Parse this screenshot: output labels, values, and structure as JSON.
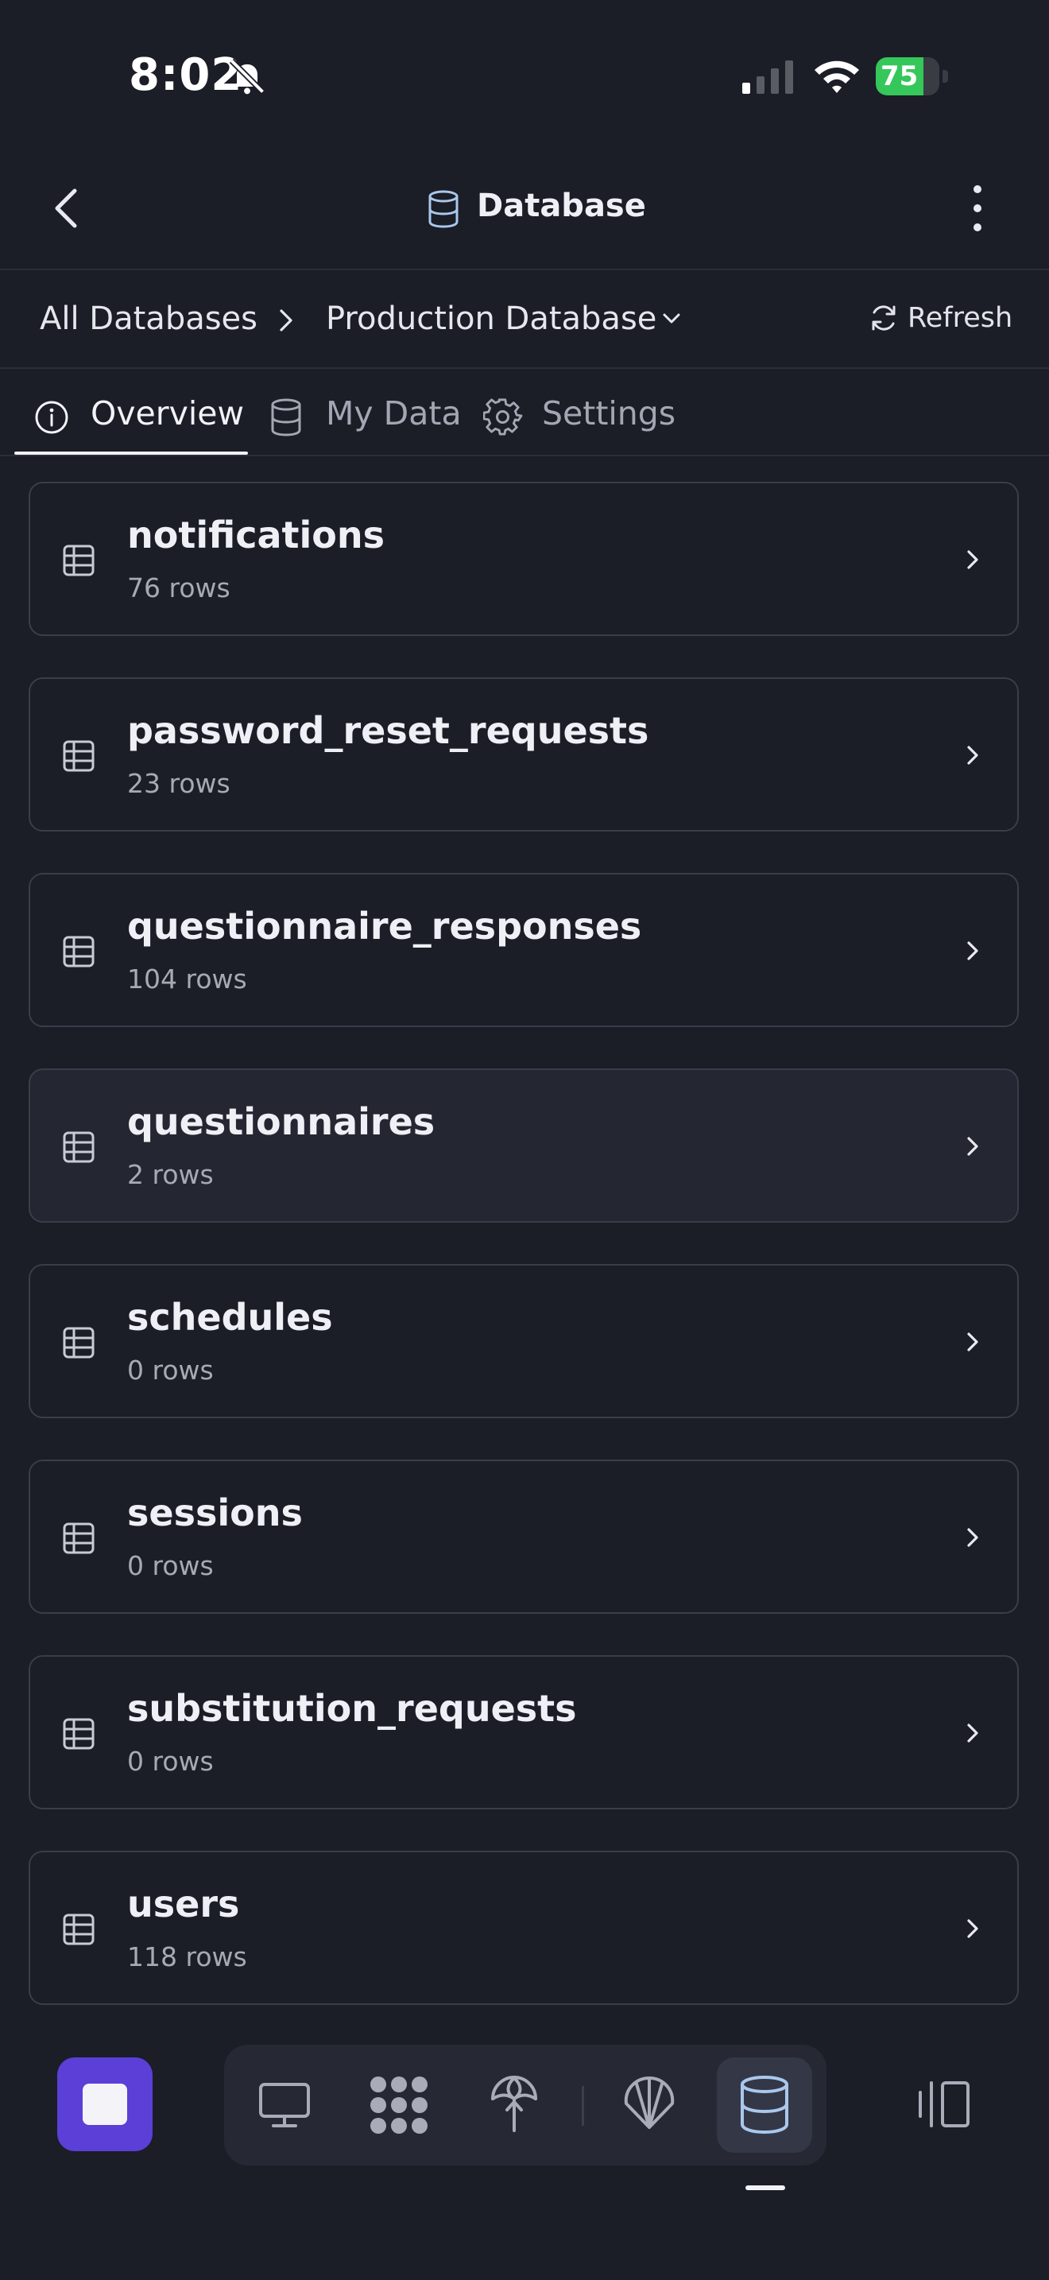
{
  "status_bar": {
    "time": "8:02",
    "battery": "75",
    "battery_level": 0.75
  },
  "header": {
    "title": "Database"
  },
  "breadcrumb": {
    "root": "All Databases",
    "current": "Production Database",
    "refresh": "Refresh"
  },
  "tabs": [
    {
      "label": "Overview",
      "active": true
    },
    {
      "label": "My Data",
      "active": false
    },
    {
      "label": "Settings",
      "active": false
    }
  ],
  "tables": [
    {
      "name": "notifications",
      "rows": "76 rows"
    },
    {
      "name": "password_reset_requests",
      "rows": "23 rows"
    },
    {
      "name": "questionnaire_responses",
      "rows": "104 rows"
    },
    {
      "name": "questionnaires",
      "rows": "2 rows",
      "highlighted": true
    },
    {
      "name": "schedules",
      "rows": "0 rows"
    },
    {
      "name": "sessions",
      "rows": "0 rows"
    },
    {
      "name": "substitution_requests",
      "rows": "0 rows"
    },
    {
      "name": "users",
      "rows": "118 rows"
    }
  ],
  "dock": {
    "items": [
      "monitor-icon",
      "apps-grid-icon",
      "antenna-icon",
      "shell-icon",
      "database-icon"
    ],
    "active": "database-icon"
  },
  "colors": {
    "background": "#1b1d27",
    "accent": "#5b3fd6",
    "battery": "#35c759",
    "db_icon": "#a9c8ec"
  }
}
